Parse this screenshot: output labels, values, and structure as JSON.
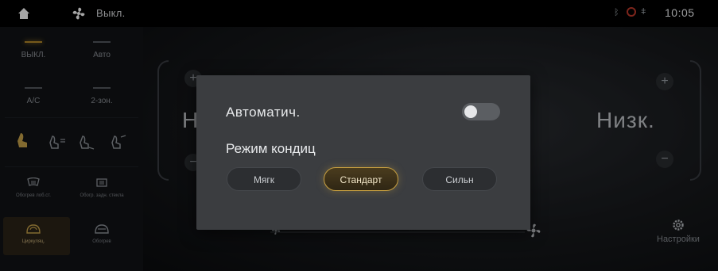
{
  "status_bar": {
    "fan_state": "Выкл.",
    "clock": "10:05",
    "bt_symbol": "ᛒ",
    "mic_symbol": "ǂ"
  },
  "left_panel": {
    "off_label": "ВЫКЛ.",
    "auto_label": "Авто",
    "ac_label": "A/C",
    "dual_zone_label": "2-зон.",
    "defrost_front_label": "Обогрев лоб.ст.",
    "defrost_rear_label": "Обогр. задн. стекла",
    "recirc_label": "Циркуляц.",
    "airflow_label": "Обогрев"
  },
  "scene": {
    "left_level": "Н",
    "right_level": "Низк.",
    "settings_label": "Настройки"
  },
  "dialog": {
    "auto_label": "Автоматич.",
    "mode_title": "Режим кондиц",
    "modes": [
      "Мягк",
      "Стандарт",
      "Сильн"
    ],
    "selected_mode": "Стандарт"
  }
}
